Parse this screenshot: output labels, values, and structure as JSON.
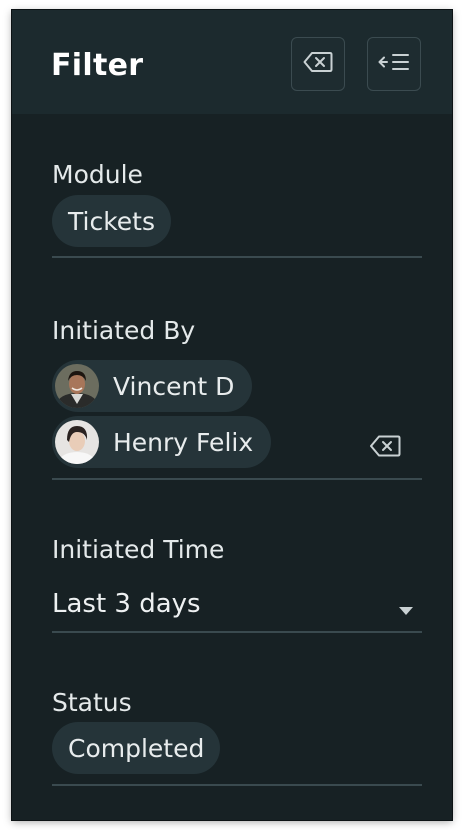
{
  "header": {
    "title": "Filter",
    "clear_icon": "backspace-clear-icon",
    "collapse_icon": "collapse-panel-icon"
  },
  "module": {
    "label": "Module",
    "chips": [
      "Tickets"
    ]
  },
  "initiated_by": {
    "label": "Initiated By",
    "people": [
      {
        "name": "Vincent D",
        "avatar": "user-avatar"
      },
      {
        "name": "Henry Felix",
        "avatar": "user-avatar"
      }
    ],
    "clear_icon": "backspace-clear-icon"
  },
  "initiated_time": {
    "label": "Initiated Time",
    "value": "Last 3 days",
    "caret_icon": "caret-down-icon"
  },
  "status": {
    "label": "Status",
    "chips": [
      "Completed"
    ]
  },
  "colors": {
    "panel_bg": "#172124",
    "header_bg": "#1c2a2e",
    "chip_bg": "#253439",
    "divider": "#3a4a4f",
    "text": "#e4e9ea"
  }
}
